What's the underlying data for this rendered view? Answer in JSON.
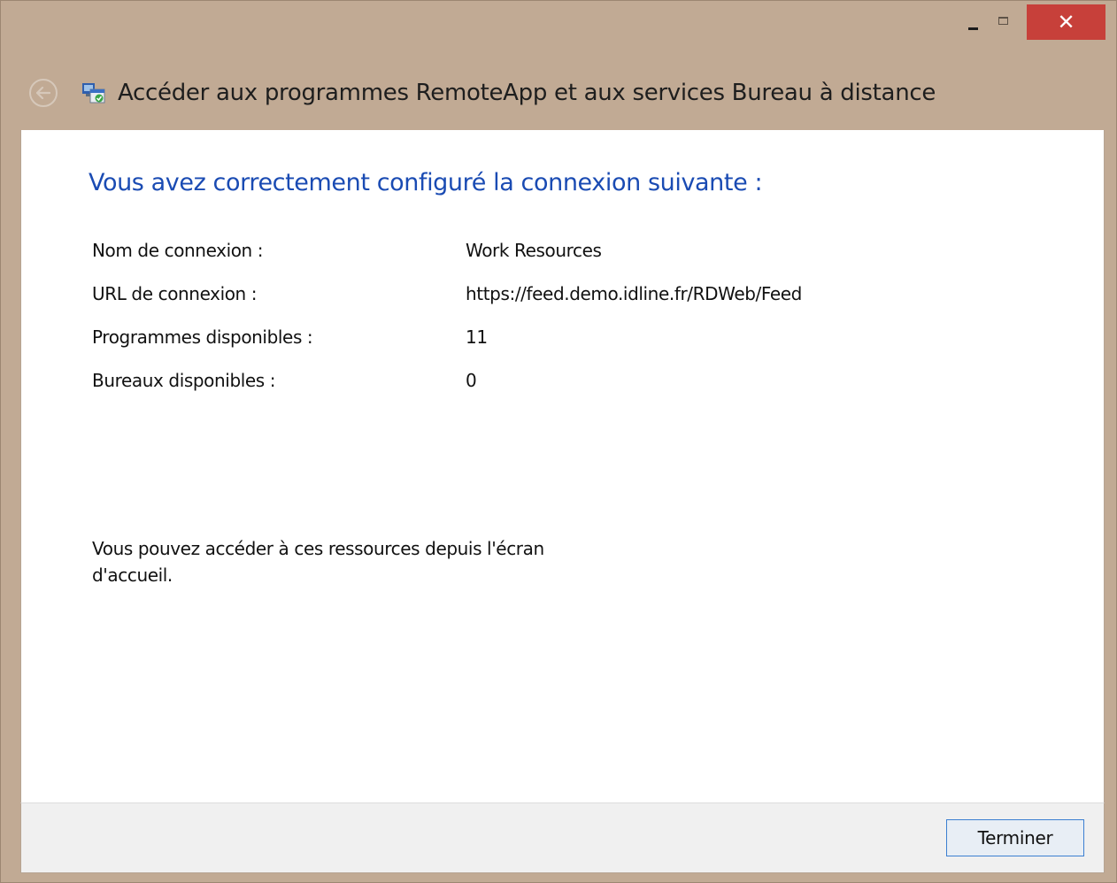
{
  "window": {
    "title": "Accéder aux programmes RemoteApp et aux services Bureau à distance",
    "caption_buttons": {
      "minimize_icon": "minimize-icon",
      "maximize_icon": "maximize-icon",
      "close_icon": "close-icon",
      "close_glyph": "✕"
    },
    "back_icon": "back-arrow-icon",
    "app_icon": "remoteapp-icon"
  },
  "main": {
    "heading": "Vous avez correctement configuré la connexion suivante :",
    "rows": [
      {
        "label": "Nom de connexion :",
        "value": "Work Resources"
      },
      {
        "label": "URL de connexion :",
        "value": "https://feed.demo.idline.fr/RDWeb/Feed"
      },
      {
        "label": "Programmes disponibles :",
        "value": "11"
      },
      {
        "label": "Bureaux disponibles :",
        "value": "0"
      }
    ],
    "note": "Vous pouvez accéder à ces ressources depuis l'écran d'accueil."
  },
  "footer": {
    "finish_label": "Terminer"
  },
  "colors": {
    "frame": "#c1aa94",
    "heading": "#1a4bb3",
    "close": "#c7403a",
    "button_border": "#3c7fd1"
  }
}
